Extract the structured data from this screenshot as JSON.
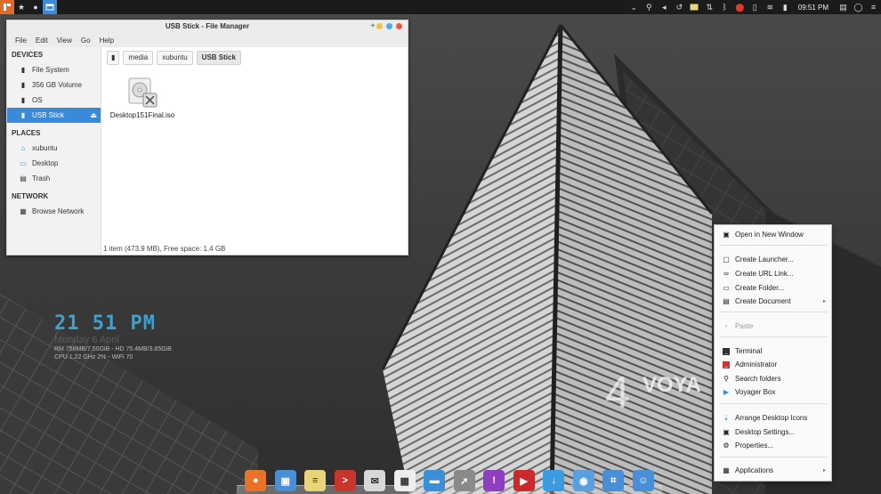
{
  "panel": {
    "left_icons": [
      "app-menu-icon",
      "favorites-star-icon",
      "dot-indicator-icon",
      "window-button-icon"
    ],
    "right_icons": [
      "dropdown-chevron-icon",
      "search-icon",
      "volume-icon",
      "history-icon",
      "notes-icon",
      "network-transfer-icon",
      "bluetooth-icon",
      "location-pin-icon",
      "clipboard-icon",
      "wifi-icon",
      "battery-icon"
    ],
    "clock": "09:51 PM",
    "tray_end_icons": [
      "workspace-switcher-icon",
      "chat-bubble-icon",
      "settings-menu-icon"
    ]
  },
  "file_manager": {
    "title": "USB Stick - File Manager",
    "menu": [
      "File",
      "Edit",
      "View",
      "Go",
      "Help"
    ],
    "sidebar": {
      "devices_heading": "DEVICES",
      "devices": [
        {
          "label": "File System",
          "icon": "harddisk-icon"
        },
        {
          "label": "356 GB Volume",
          "icon": "harddisk-icon"
        },
        {
          "label": "OS",
          "icon": "harddisk-icon"
        },
        {
          "label": "USB Stick",
          "icon": "usb-drive-icon",
          "active": true
        }
      ],
      "places_heading": "PLACES",
      "places": [
        {
          "label": "xubuntu",
          "icon": "home-icon"
        },
        {
          "label": "Desktop",
          "icon": "desktop-icon"
        },
        {
          "label": "Trash",
          "icon": "trash-icon"
        }
      ],
      "network_heading": "NETWORK",
      "network": [
        {
          "label": "Browse Network",
          "icon": "network-icon"
        }
      ]
    },
    "path": [
      "media",
      "xubuntu",
      "USB Stick"
    ],
    "file": {
      "name": "Desktop151Final.iso"
    },
    "status": "1 item (473.9 MB), Free space: 1.4 GB"
  },
  "conky": {
    "time": "21 51 PM",
    "date": "Monday 6 April",
    "line1": "RM 758MB/7.50GiB - HD 75.4MB/3.85GiB",
    "line2": "CPU 1.22 GHz 2% - WiFi 70"
  },
  "context_menu": {
    "items": [
      {
        "label": "Open in New Window",
        "icon": "new-window-icon",
        "disabled": false
      },
      {
        "label": "Create Launcher...",
        "icon": "launcher-icon",
        "disabled": false
      },
      {
        "label": "Create URL Link...",
        "icon": "link-icon",
        "disabled": false
      },
      {
        "label": "Create Folder...",
        "icon": "folder-icon",
        "disabled": false
      },
      {
        "label": "Create Document",
        "icon": "document-icon",
        "disabled": false,
        "submenu": true
      },
      {
        "label": "Paste",
        "icon": "paste-icon",
        "disabled": true
      },
      {
        "label": "Terminal",
        "icon": "terminal-icon",
        "disabled": false
      },
      {
        "label": "Administrator",
        "icon": "administrator-icon",
        "disabled": false
      },
      {
        "label": "Search folders",
        "icon": "search-icon",
        "disabled": false
      },
      {
        "label": "Voyager Box",
        "icon": "play-arrow-icon",
        "disabled": false
      },
      {
        "label": "Arrange Desktop Icons",
        "icon": "arrange-icon",
        "disabled": false
      },
      {
        "label": "Desktop Settings...",
        "icon": "desktop-settings-icon",
        "disabled": false
      },
      {
        "label": "Properties...",
        "icon": "properties-icon",
        "disabled": false
      },
      {
        "label": "Applications",
        "icon": "applications-icon",
        "disabled": false,
        "submenu": true
      }
    ]
  },
  "wallpaper_text": {
    "number": "4",
    "word": "VOYA"
  },
  "dock": {
    "items": [
      {
        "name": "firefox-icon",
        "color": "#e8722a",
        "glyph": "●"
      },
      {
        "name": "contacts-icon",
        "color": "#4a8fd6",
        "glyph": "▣"
      },
      {
        "name": "notes-icon",
        "color": "#e8d57a",
        "glyph": "≡"
      },
      {
        "name": "presentation-icon",
        "color": "#c7352b",
        "glyph": ">"
      },
      {
        "name": "mail-icon",
        "color": "#d8d8d8",
        "glyph": "✉"
      },
      {
        "name": "tiles-icon",
        "color": "#eeeeee",
        "glyph": "▦"
      },
      {
        "name": "desktop-folder-icon",
        "color": "#3b8ed8",
        "glyph": "▬"
      },
      {
        "name": "rocket-launcher-icon",
        "color": "#8a8a8a",
        "glyph": "➚"
      },
      {
        "name": "messenger-icon",
        "color": "#8e3fbf",
        "glyph": "!"
      },
      {
        "name": "youtube-icon",
        "color": "#cc2a2a",
        "glyph": "▶"
      },
      {
        "name": "download-icon",
        "color": "#3b9be0",
        "glyph": "↓"
      },
      {
        "name": "toggle-icon",
        "color": "#5a9fe0",
        "glyph": "◉"
      },
      {
        "name": "calculator-icon",
        "color": "#4a8fd6",
        "glyph": "⌗"
      },
      {
        "name": "user-icon",
        "color": "#4a8fd6",
        "glyph": "☺"
      }
    ]
  },
  "colors": {
    "accent": "#3a8ad9",
    "panel_bg": "#1b1b1b",
    "conky_time": "#3fa0d0",
    "win_btn_yellow": "#f5c342",
    "win_btn_blue": "#5aa9e6",
    "win_btn_red": "#e9573f"
  }
}
